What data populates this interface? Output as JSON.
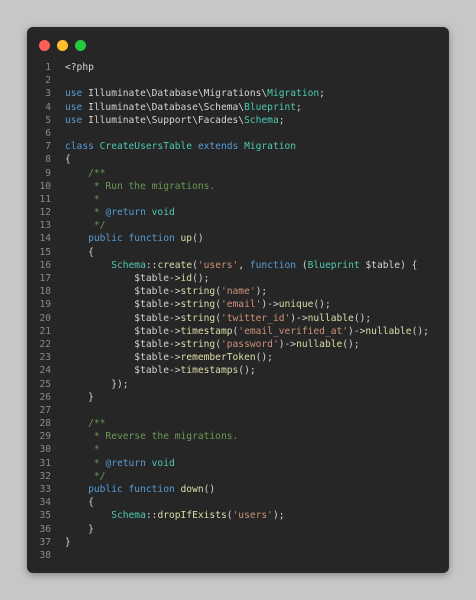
{
  "window": {
    "controls": [
      {
        "name": "close",
        "color": "#ff5f56"
      },
      {
        "name": "minimize",
        "color": "#ffbd2e"
      },
      {
        "name": "maximize",
        "color": "#27c93f"
      }
    ]
  },
  "code": {
    "language": "php",
    "lines": [
      {
        "n": "1",
        "tokens": [
          {
            "t": "<?php",
            "c": "plain"
          }
        ]
      },
      {
        "n": "2",
        "tokens": []
      },
      {
        "n": "3",
        "tokens": [
          {
            "t": "use ",
            "c": "keyword"
          },
          {
            "t": "Illuminate\\Database\\Migrations\\",
            "c": "plain"
          },
          {
            "t": "Migration",
            "c": "class"
          },
          {
            "t": ";",
            "c": "plain"
          }
        ]
      },
      {
        "n": "4",
        "tokens": [
          {
            "t": "use ",
            "c": "keyword"
          },
          {
            "t": "Illuminate\\Database\\Schema\\",
            "c": "plain"
          },
          {
            "t": "Blueprint",
            "c": "class"
          },
          {
            "t": ";",
            "c": "plain"
          }
        ]
      },
      {
        "n": "5",
        "tokens": [
          {
            "t": "use ",
            "c": "keyword"
          },
          {
            "t": "Illuminate\\Support\\Facades\\",
            "c": "plain"
          },
          {
            "t": "Schema",
            "c": "class"
          },
          {
            "t": ";",
            "c": "plain"
          }
        ]
      },
      {
        "n": "6",
        "tokens": []
      },
      {
        "n": "7",
        "tokens": [
          {
            "t": "class ",
            "c": "keyword"
          },
          {
            "t": "CreateUsersTable ",
            "c": "class"
          },
          {
            "t": "extends ",
            "c": "keyword"
          },
          {
            "t": "Migration",
            "c": "class"
          }
        ]
      },
      {
        "n": "8",
        "tokens": [
          {
            "t": "{",
            "c": "plain"
          }
        ]
      },
      {
        "n": "9",
        "tokens": [
          {
            "t": "    /**",
            "c": "comment"
          }
        ]
      },
      {
        "n": "10",
        "tokens": [
          {
            "t": "     * Run the migrations.",
            "c": "comment"
          }
        ]
      },
      {
        "n": "11",
        "tokens": [
          {
            "t": "     *",
            "c": "comment"
          }
        ]
      },
      {
        "n": "12",
        "tokens": [
          {
            "t": "     * ",
            "c": "comment"
          },
          {
            "t": "@return ",
            "c": "doctag"
          },
          {
            "t": "void",
            "c": "class"
          }
        ]
      },
      {
        "n": "13",
        "tokens": [
          {
            "t": "     */",
            "c": "comment"
          }
        ]
      },
      {
        "n": "14",
        "tokens": [
          {
            "t": "    public function ",
            "c": "keyword"
          },
          {
            "t": "up",
            "c": "function"
          },
          {
            "t": "()",
            "c": "plain"
          }
        ]
      },
      {
        "n": "15",
        "tokens": [
          {
            "t": "    {",
            "c": "plain"
          }
        ]
      },
      {
        "n": "16",
        "tokens": [
          {
            "t": "        Schema",
            "c": "class"
          },
          {
            "t": "::",
            "c": "plain"
          },
          {
            "t": "create",
            "c": "function"
          },
          {
            "t": "(",
            "c": "plain"
          },
          {
            "t": "'users'",
            "c": "string"
          },
          {
            "t": ", ",
            "c": "plain"
          },
          {
            "t": "function ",
            "c": "keyword"
          },
          {
            "t": "(",
            "c": "plain"
          },
          {
            "t": "Blueprint ",
            "c": "class"
          },
          {
            "t": "$table",
            "c": "variable"
          },
          {
            "t": ") {",
            "c": "plain"
          }
        ]
      },
      {
        "n": "17",
        "tokens": [
          {
            "t": "            $table",
            "c": "variable"
          },
          {
            "t": "->",
            "c": "plain"
          },
          {
            "t": "id",
            "c": "function"
          },
          {
            "t": "();",
            "c": "plain"
          }
        ]
      },
      {
        "n": "18",
        "tokens": [
          {
            "t": "            $table",
            "c": "variable"
          },
          {
            "t": "->",
            "c": "plain"
          },
          {
            "t": "string",
            "c": "function"
          },
          {
            "t": "(",
            "c": "plain"
          },
          {
            "t": "'name'",
            "c": "string"
          },
          {
            "t": ");",
            "c": "plain"
          }
        ]
      },
      {
        "n": "19",
        "tokens": [
          {
            "t": "            $table",
            "c": "variable"
          },
          {
            "t": "->",
            "c": "plain"
          },
          {
            "t": "string",
            "c": "function"
          },
          {
            "t": "(",
            "c": "plain"
          },
          {
            "t": "'email'",
            "c": "string"
          },
          {
            "t": ")->",
            "c": "plain"
          },
          {
            "t": "unique",
            "c": "function"
          },
          {
            "t": "();",
            "c": "plain"
          }
        ]
      },
      {
        "n": "20",
        "tokens": [
          {
            "t": "            $table",
            "c": "variable"
          },
          {
            "t": "->",
            "c": "plain"
          },
          {
            "t": "string",
            "c": "function"
          },
          {
            "t": "(",
            "c": "plain"
          },
          {
            "t": "'twitter_id'",
            "c": "string"
          },
          {
            "t": ")->",
            "c": "plain"
          },
          {
            "t": "nullable",
            "c": "function"
          },
          {
            "t": "();",
            "c": "plain"
          }
        ]
      },
      {
        "n": "21",
        "tokens": [
          {
            "t": "            $table",
            "c": "variable"
          },
          {
            "t": "->",
            "c": "plain"
          },
          {
            "t": "timestamp",
            "c": "function"
          },
          {
            "t": "(",
            "c": "plain"
          },
          {
            "t": "'email_verified_at'",
            "c": "string"
          },
          {
            "t": ")->",
            "c": "plain"
          },
          {
            "t": "nullable",
            "c": "function"
          },
          {
            "t": "();",
            "c": "plain"
          }
        ]
      },
      {
        "n": "22",
        "tokens": [
          {
            "t": "            $table",
            "c": "variable"
          },
          {
            "t": "->",
            "c": "plain"
          },
          {
            "t": "string",
            "c": "function"
          },
          {
            "t": "(",
            "c": "plain"
          },
          {
            "t": "'password'",
            "c": "string"
          },
          {
            "t": ")->",
            "c": "plain"
          },
          {
            "t": "nullable",
            "c": "function"
          },
          {
            "t": "();",
            "c": "plain"
          }
        ]
      },
      {
        "n": "23",
        "tokens": [
          {
            "t": "            $table",
            "c": "variable"
          },
          {
            "t": "->",
            "c": "plain"
          },
          {
            "t": "rememberToken",
            "c": "function"
          },
          {
            "t": "();",
            "c": "plain"
          }
        ]
      },
      {
        "n": "24",
        "tokens": [
          {
            "t": "            $table",
            "c": "variable"
          },
          {
            "t": "->",
            "c": "plain"
          },
          {
            "t": "timestamps",
            "c": "function"
          },
          {
            "t": "();",
            "c": "plain"
          }
        ]
      },
      {
        "n": "25",
        "tokens": [
          {
            "t": "        });",
            "c": "plain"
          }
        ]
      },
      {
        "n": "26",
        "tokens": [
          {
            "t": "    }",
            "c": "plain"
          }
        ]
      },
      {
        "n": "27",
        "tokens": []
      },
      {
        "n": "28",
        "tokens": [
          {
            "t": "    /**",
            "c": "comment"
          }
        ]
      },
      {
        "n": "29",
        "tokens": [
          {
            "t": "     * Reverse the migrations.",
            "c": "comment"
          }
        ]
      },
      {
        "n": "30",
        "tokens": [
          {
            "t": "     *",
            "c": "comment"
          }
        ]
      },
      {
        "n": "31",
        "tokens": [
          {
            "t": "     * ",
            "c": "comment"
          },
          {
            "t": "@return ",
            "c": "doctag"
          },
          {
            "t": "void",
            "c": "class"
          }
        ]
      },
      {
        "n": "32",
        "tokens": [
          {
            "t": "     */",
            "c": "comment"
          }
        ]
      },
      {
        "n": "33",
        "tokens": [
          {
            "t": "    public function ",
            "c": "keyword"
          },
          {
            "t": "down",
            "c": "function"
          },
          {
            "t": "()",
            "c": "plain"
          }
        ]
      },
      {
        "n": "34",
        "tokens": [
          {
            "t": "    {",
            "c": "plain"
          }
        ]
      },
      {
        "n": "35",
        "tokens": [
          {
            "t": "        Schema",
            "c": "class"
          },
          {
            "t": "::",
            "c": "plain"
          },
          {
            "t": "dropIfExists",
            "c": "function"
          },
          {
            "t": "(",
            "c": "plain"
          },
          {
            "t": "'users'",
            "c": "string"
          },
          {
            "t": ");",
            "c": "plain"
          }
        ]
      },
      {
        "n": "36",
        "tokens": [
          {
            "t": "    }",
            "c": "plain"
          }
        ]
      },
      {
        "n": "37",
        "tokens": [
          {
            "t": "}",
            "c": "plain"
          }
        ]
      },
      {
        "n": "38",
        "tokens": []
      }
    ]
  }
}
